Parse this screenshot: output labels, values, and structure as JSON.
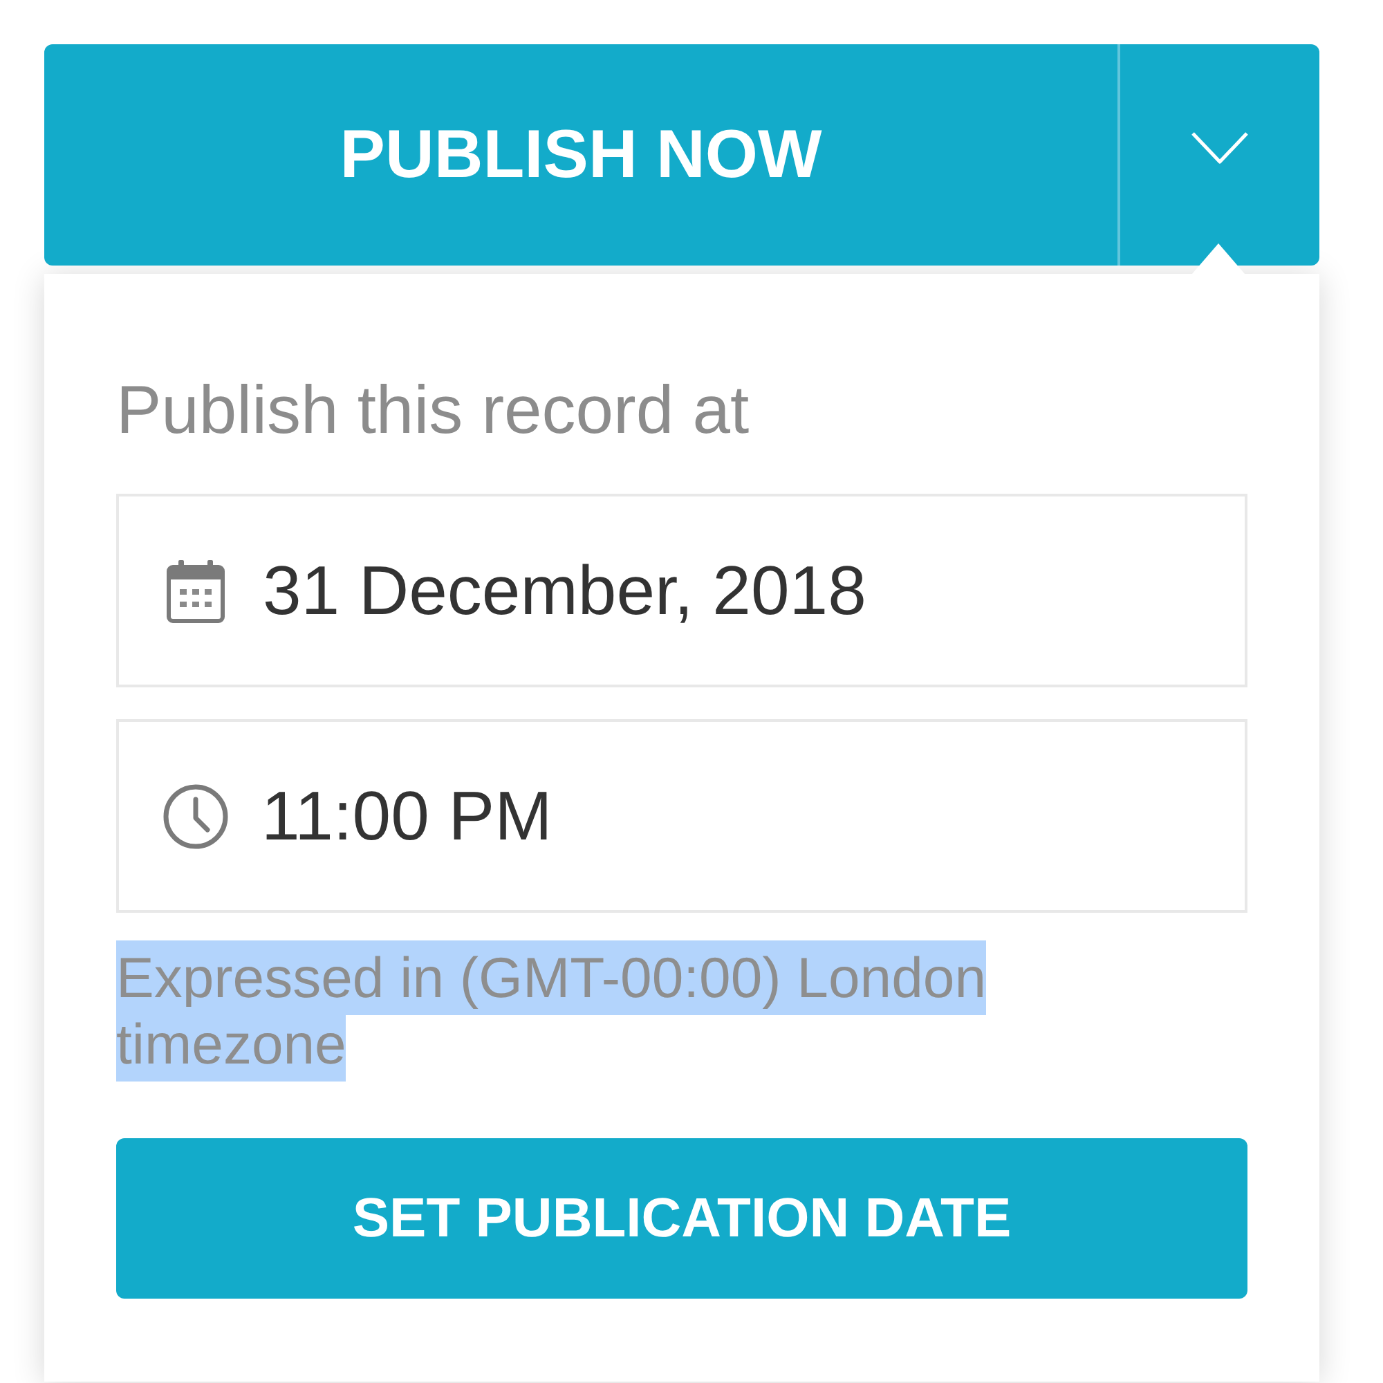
{
  "publish_button": {
    "label": "PUBLISH NOW"
  },
  "dropdown_toggle": {
    "expanded": true
  },
  "schedule_panel": {
    "heading": "Publish this record at",
    "fields": [
      {
        "kind": "date",
        "value": "31 December, 2018"
      },
      {
        "kind": "time",
        "value": "11:00 PM"
      }
    ],
    "timezone_note": {
      "text": "Expressed in (GMT-00:00) London timezone",
      "text_selected": true
    },
    "submit_button": {
      "label": "SET PUBLICATION DATE"
    }
  }
}
